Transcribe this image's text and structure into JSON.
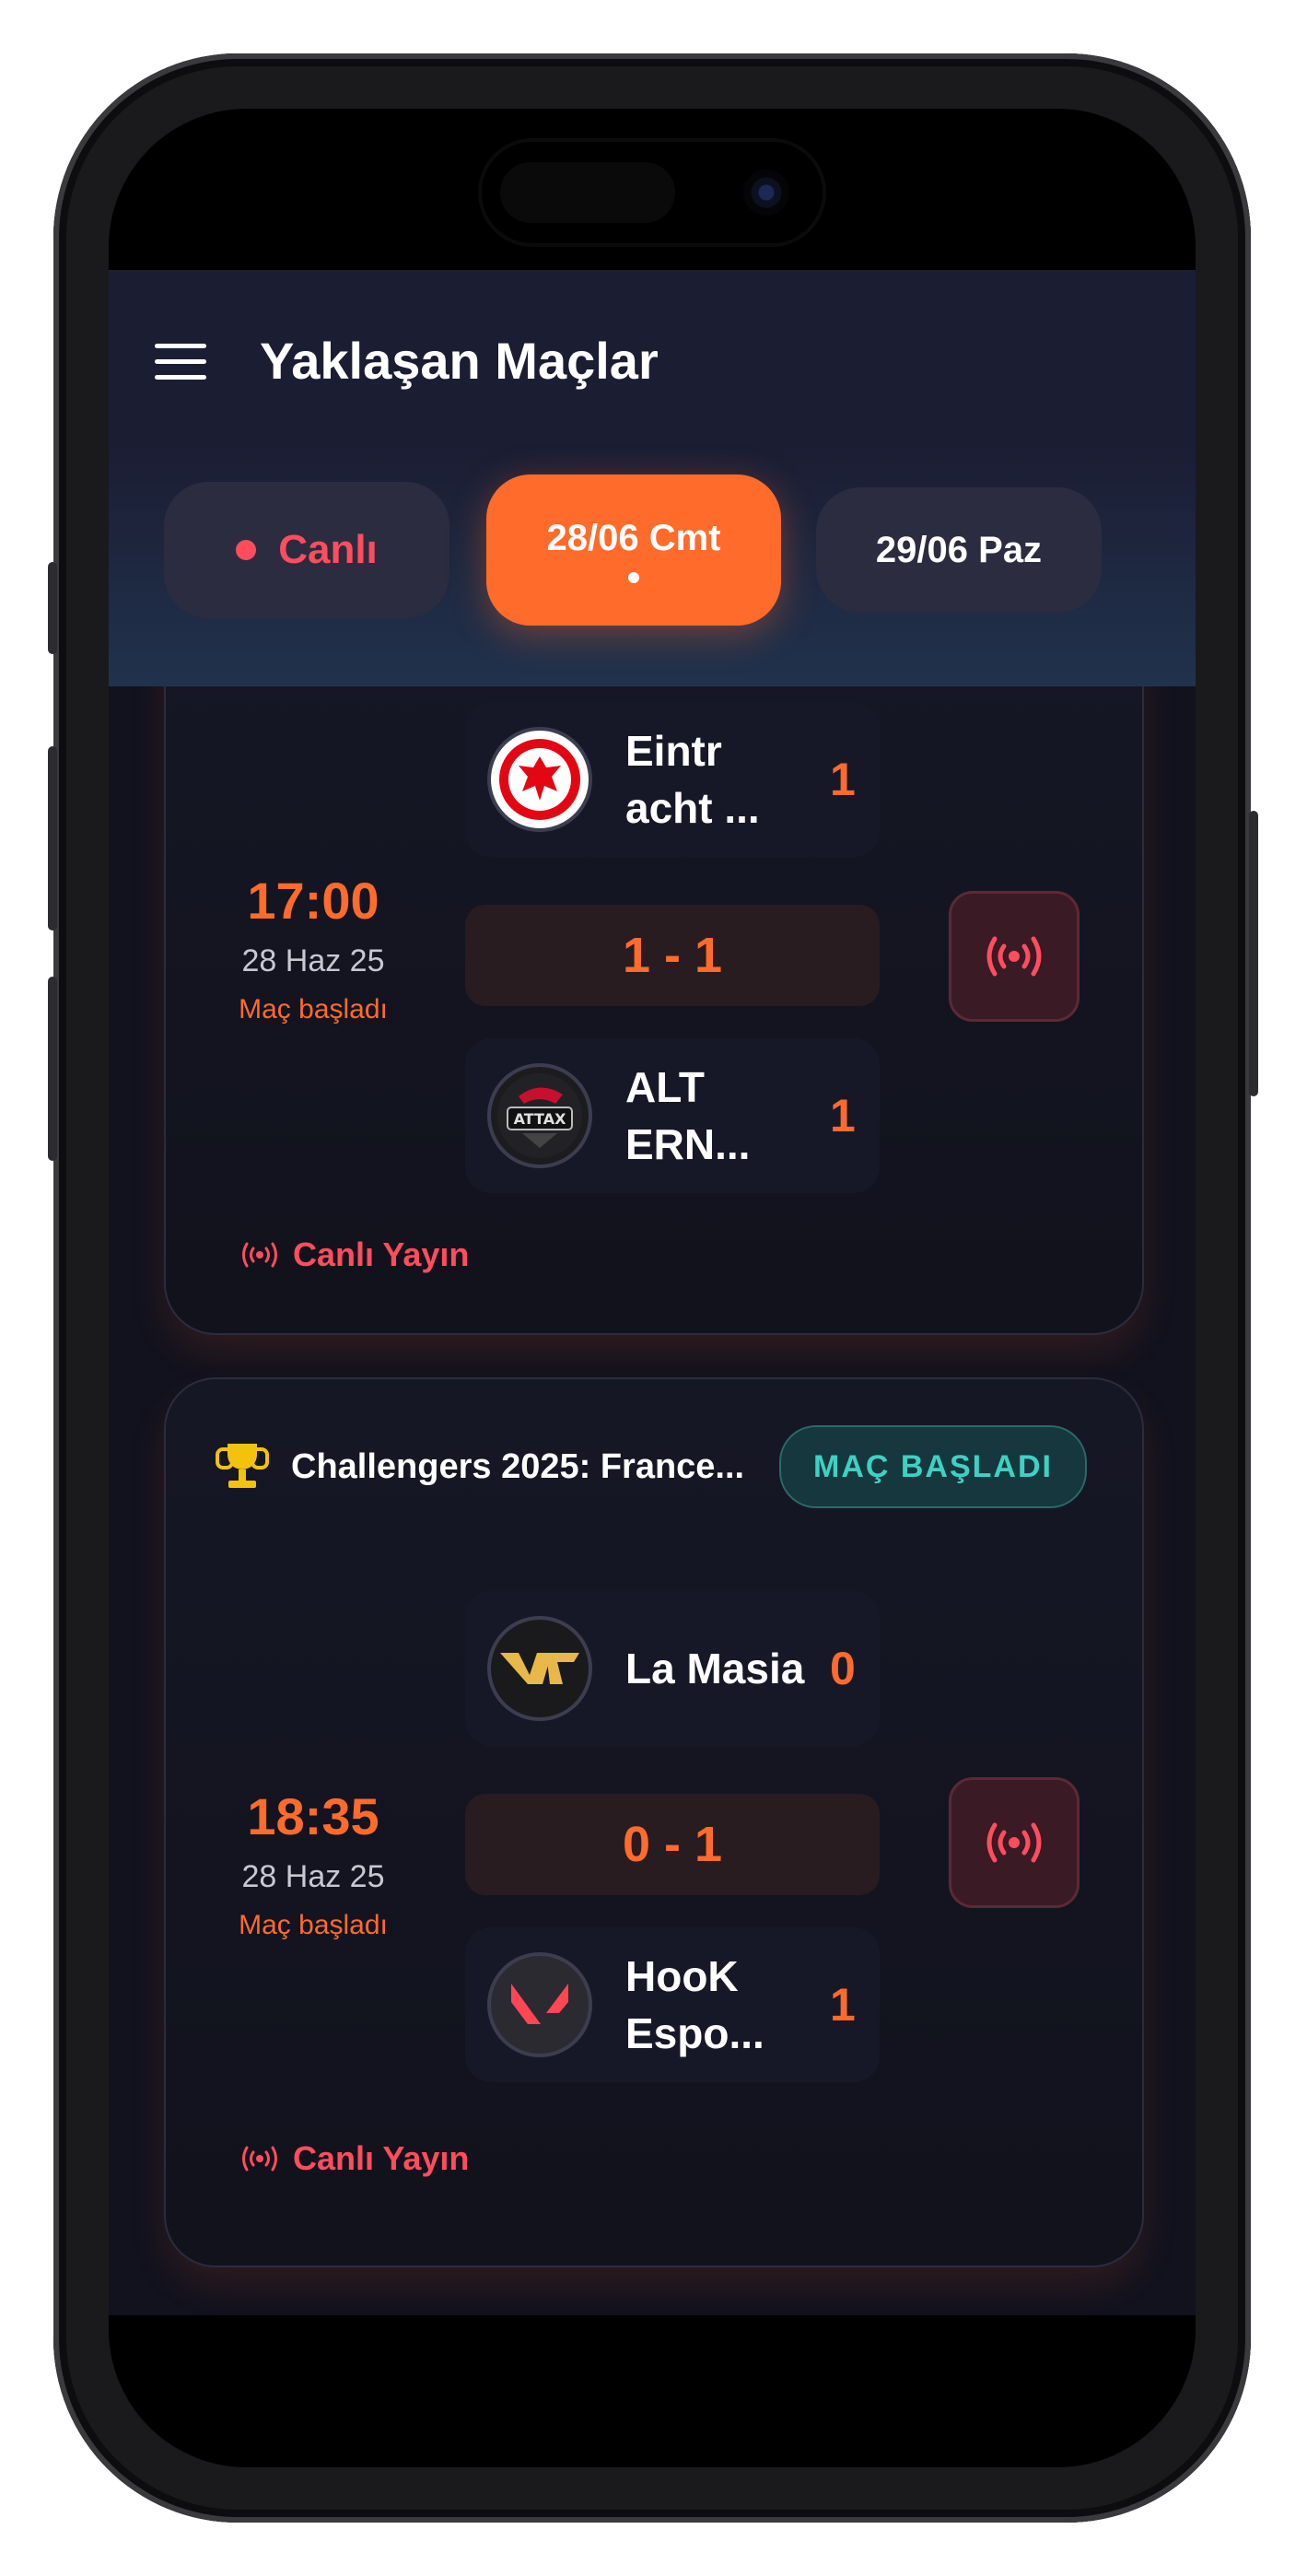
{
  "header": {
    "title": "Yaklaşan Maçlar",
    "menu_icon": "menu-icon"
  },
  "tabs": [
    {
      "label": "Canlı",
      "icon": "live-dot-icon",
      "color": "#ff4d5e"
    },
    {
      "label": "28/06 Cmt",
      "active": true,
      "color": "#ff6b2b"
    },
    {
      "label": "29/06 Paz"
    }
  ],
  "matches": [
    {
      "time": "17:00",
      "date": "28 Haz 25",
      "status": "Maç başladı",
      "team1": {
        "name": "Eintr acht ...",
        "score": "1",
        "logo": "eintracht-eagle-logo"
      },
      "score": "1 - 1",
      "team2": {
        "name": "ALT ERN...",
        "score": "1",
        "logo": "alternate-attax-logo"
      },
      "live_button_icon": "broadcast-icon",
      "stream_label": "Canlı Yayın"
    },
    {
      "tournament": "Challengers 2025: France...",
      "badge": "MAÇ BAŞLADI",
      "time": "18:35",
      "date": "28 Haz 25",
      "status": "Maç başladı",
      "team1": {
        "name": "La Masia",
        "score": "0",
        "logo": "la-masia-logo"
      },
      "score": "0 - 1",
      "team2": {
        "name": "HooK Espo...",
        "score": "1",
        "logo": "valorant-logo"
      },
      "live_button_icon": "broadcast-icon",
      "stream_label": "Canlı Yayın"
    }
  ],
  "colors": {
    "accent": "#ff6b2b",
    "live": "#ff4d5e",
    "badge": "#3ed1c3",
    "background": "#11121e"
  }
}
